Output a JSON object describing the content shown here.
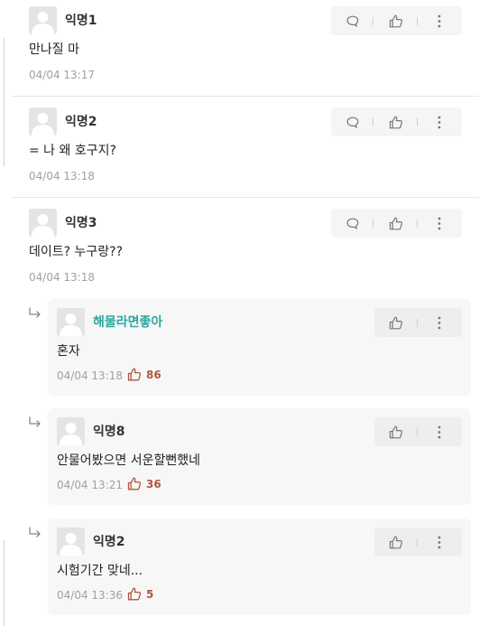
{
  "comments": [
    {
      "author": "익명1",
      "text": "만나질 마",
      "time": "04/04 13:17"
    },
    {
      "author": "익명2",
      "text": "= 나 왜 호구지?",
      "time": "04/04 13:18"
    },
    {
      "author": "익명3",
      "text": "데이트? 누구랑??",
      "time": "04/04 13:18"
    }
  ],
  "replies": [
    {
      "author": "해물라면좋아",
      "text": "혼자",
      "time": "04/04 13:18",
      "likes": "86"
    },
    {
      "author": "익명8",
      "text": "안물어봤으면 서운할뻔했네",
      "time": "04/04 13:21",
      "likes": "36"
    },
    {
      "author": "익명2",
      "text": "시험기간 맞네...",
      "time": "04/04 13:36",
      "likes": "5"
    }
  ],
  "icons": {
    "avatar": "default-avatar-icon",
    "reply": "speech-bubble-icon",
    "like": "thumbs-up-icon",
    "more": "vertical-dots-icon",
    "thread": "reply-arrow-icon"
  },
  "colors": {
    "highlight_author": "#2aa8a0",
    "like_count": "#b0563b"
  }
}
